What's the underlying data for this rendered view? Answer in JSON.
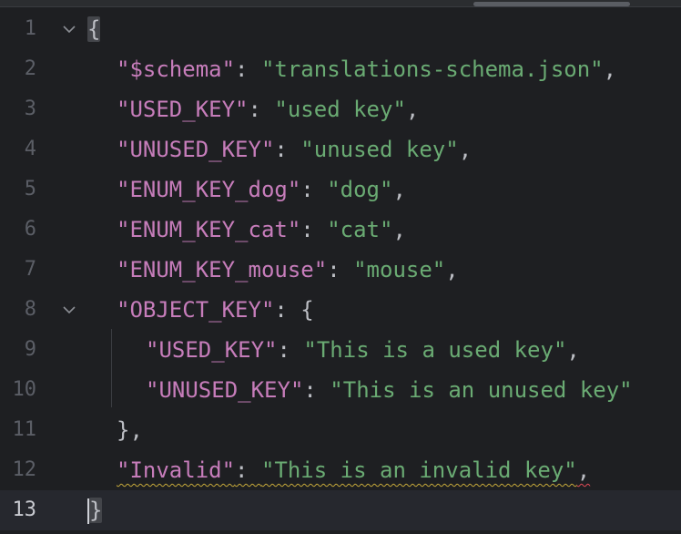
{
  "editor": {
    "file_content_language": "json",
    "colors": {
      "background": "#1e1f22",
      "key": "#c77dbb",
      "string": "#6aab73",
      "punctuation": "#bcbec4",
      "line_number": "#5b5e66",
      "warning_underline": "#c6a93a",
      "error_underline": "#e04a55"
    },
    "lines": [
      {
        "num": "1",
        "open": "{"
      },
      {
        "num": "2",
        "key": "\"$schema\"",
        "colon": ": ",
        "value": "\"translations-schema.json\"",
        "tail": ","
      },
      {
        "num": "3",
        "key": "\"USED_KEY\"",
        "colon": ": ",
        "value": "\"used key\"",
        "tail": ","
      },
      {
        "num": "4",
        "key": "\"UNUSED_KEY\"",
        "colon": ": ",
        "value": "\"unused key\"",
        "tail": ","
      },
      {
        "num": "5",
        "key": "\"ENUM_KEY_dog\"",
        "colon": ": ",
        "value": "\"dog\"",
        "tail": ","
      },
      {
        "num": "6",
        "key": "\"ENUM_KEY_cat\"",
        "colon": ": ",
        "value": "\"cat\"",
        "tail": ","
      },
      {
        "num": "7",
        "key": "\"ENUM_KEY_mouse\"",
        "colon": ": ",
        "value": "\"mouse\"",
        "tail": ","
      },
      {
        "num": "8",
        "key": "\"OBJECT_KEY\"",
        "colon": ": ",
        "tail": "{"
      },
      {
        "num": "9",
        "key": "\"USED_KEY\"",
        "colon": ": ",
        "value": "\"This is a used key\"",
        "tail": ","
      },
      {
        "num": "10",
        "key": "\"UNUSED_KEY\"",
        "colon": ": ",
        "value": "\"This is an unused key\""
      },
      {
        "num": "11",
        "close": "},"
      },
      {
        "num": "12",
        "key": "\"Invalid\"",
        "colon": ": ",
        "value": "\"This is an invalid key\"",
        "tail": ","
      },
      {
        "num": "13",
        "close": "}"
      }
    ],
    "fold_icon": "chevron-down-icon",
    "current_line": "13"
  }
}
